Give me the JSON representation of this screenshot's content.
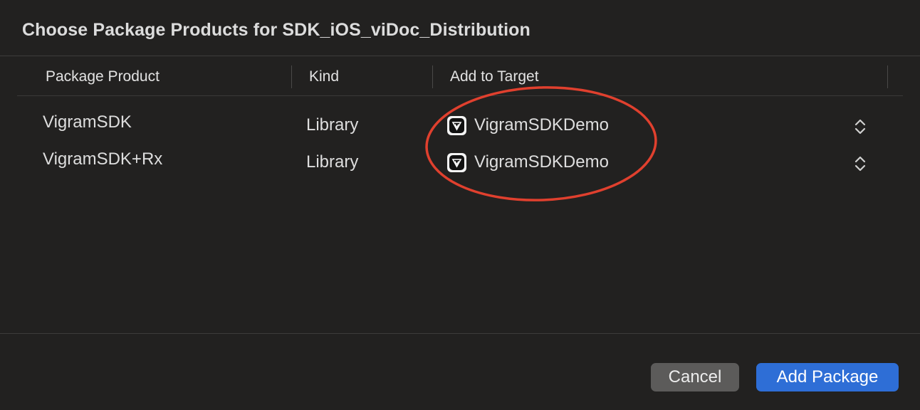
{
  "dialog": {
    "title": "Choose Package Products for SDK_iOS_viDoc_Distribution"
  },
  "table": {
    "columns": [
      "Package Product",
      "Kind",
      "Add to Target"
    ],
    "rows": [
      {
        "product": "VigramSDK",
        "kind": "Library",
        "target": "VigramSDKDemo",
        "target_icon": "app-icon",
        "control_icon": "chevron-up-down-icon"
      },
      {
        "product": "VigramSDK+Rx",
        "kind": "Library",
        "target": "VigramSDKDemo",
        "target_icon": "app-icon",
        "control_icon": "chevron-up-down-icon"
      }
    ]
  },
  "footer": {
    "cancel_label": "Cancel",
    "add_label": "Add Package"
  },
  "colors": {
    "background": "#222120",
    "accent": "#2e6ed6",
    "annotation": "#e0402e"
  }
}
